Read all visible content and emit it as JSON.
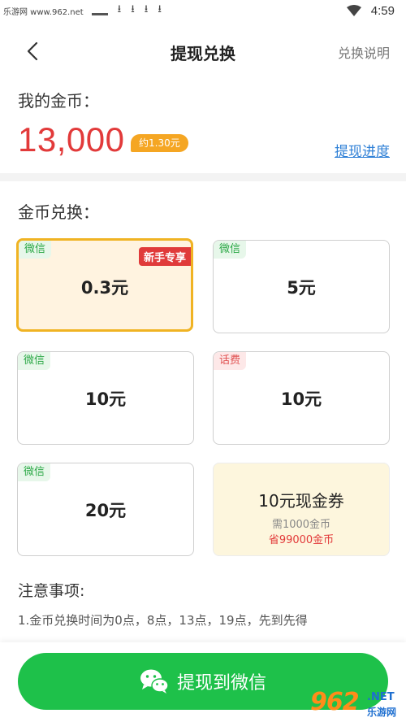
{
  "status_bar": {
    "watermark": "乐游网 www.962.net",
    "time": "4:59"
  },
  "nav": {
    "title": "提现兑换",
    "help_link": "兑换说明"
  },
  "coins": {
    "label": "我的金币：",
    "value": "13,000",
    "approx": "约1.30元",
    "progress_link": "提现进度"
  },
  "exchange": {
    "title": "金币兑换：",
    "options": [
      {
        "tag": "微信",
        "amount": "0.3元",
        "badge": "新手专享"
      },
      {
        "tag": "微信",
        "amount": "5元"
      },
      {
        "tag": "微信",
        "amount": "10元"
      },
      {
        "tag": "话费",
        "amount": "10元"
      },
      {
        "tag": "微信",
        "amount": "20元"
      }
    ],
    "voucher": {
      "title": "10元现金券",
      "need": "需1000金币",
      "save": "省99000金币"
    }
  },
  "notes": {
    "title": "注意事项:",
    "line1": "1.金币兑换时间为0点，8点，13点，19点，先到先得"
  },
  "action": {
    "withdraw_label": "提现到微信"
  },
  "watermark": {
    "number": "962",
    "net": ".NET",
    "cn": "乐游网"
  },
  "colors": {
    "accent_green": "#1ec14a",
    "coin_red": "#e23a3a",
    "link_blue": "#2d7fd6",
    "selected_border": "#f0b323"
  }
}
